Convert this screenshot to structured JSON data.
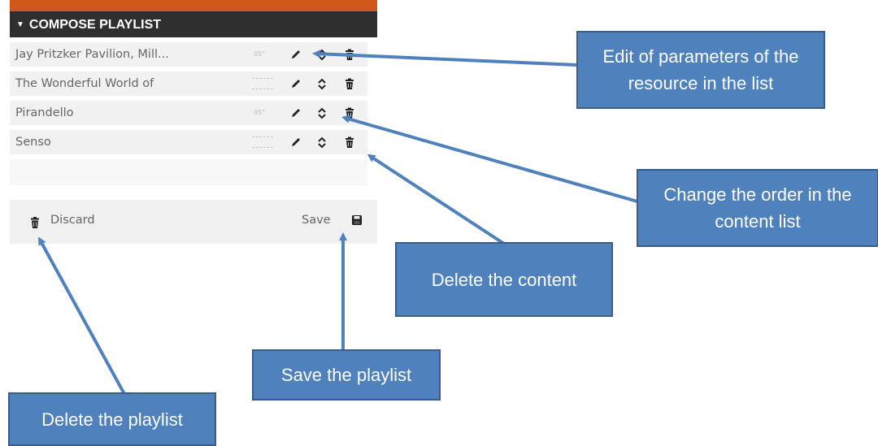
{
  "panel": {
    "header": "COMPOSE PLAYLIST",
    "items": [
      {
        "title": "Jay Pritzker Pavilion, Mill...",
        "duration": "05\""
      },
      {
        "title": "The Wonderful World of",
        "duration": ""
      },
      {
        "title": "Pirandello",
        "duration": "05\""
      },
      {
        "title": "Senso",
        "duration": ""
      }
    ],
    "footer": {
      "discard_label": "Discard",
      "save_label": "Save"
    }
  },
  "callouts": {
    "edit": "Edit of parameters of the resource in the list",
    "order": "Change the order in the content list",
    "delete_content": "Delete the content",
    "save_playlist": "Save the playlist",
    "delete_playlist": "Delete the playlist"
  },
  "icons": {
    "edit": "pencil-icon",
    "order": "up-down-arrows-icon",
    "delete": "trash-icon",
    "save": "floppy-disk-icon",
    "collapse": "triangle-down-icon"
  },
  "colors": {
    "callout_fill": "#4f81bd",
    "callout_border": "#385d8a",
    "header_bg": "#2f2f2f",
    "accent_bar": "#d2571b"
  }
}
